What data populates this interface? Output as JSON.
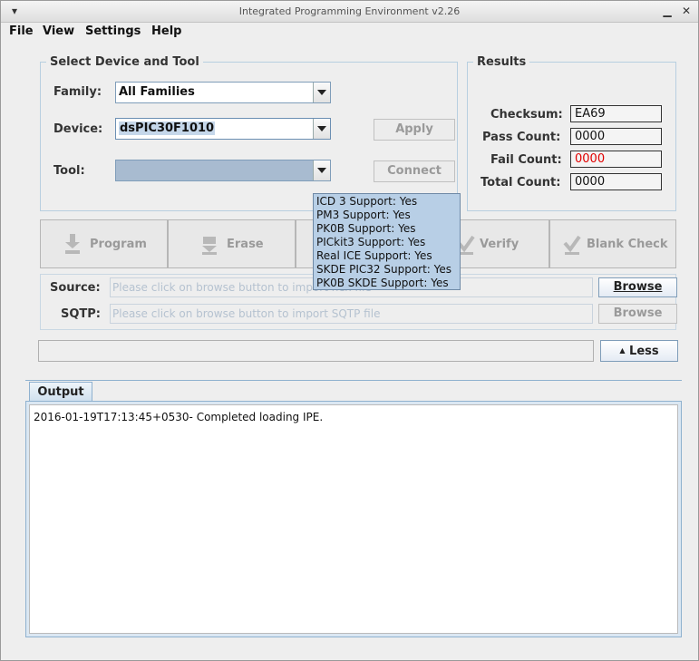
{
  "window": {
    "title": "Integrated Programming Environment v2.26",
    "menu_glyph": "▾",
    "minimize_glyph": "▁",
    "close_glyph": "✕"
  },
  "menu": [
    "File",
    "View",
    "Settings",
    "Help"
  ],
  "device_tool": {
    "group_title": "Select Device and Tool",
    "family_label": "Family:",
    "family_value": "All Families",
    "device_label": "Device:",
    "device_value": "dsPIC30F1010",
    "tool_label": "Tool:",
    "tool_value": "",
    "apply_label": "Apply",
    "connect_label": "Connect"
  },
  "results": {
    "group_title": "Results",
    "checksum_label": "Checksum:",
    "checksum_value": "EA69",
    "pass_label": "Pass Count:",
    "pass_value": "0000",
    "fail_label": "Fail Count:",
    "fail_value": "0000",
    "total_label": "Total Count:",
    "total_value": "0000",
    "fail_color": "#e00000"
  },
  "actions": {
    "program": "Program",
    "erase": "Erase",
    "verify": "Verify",
    "blank_check": "Blank Check"
  },
  "tooltip": [
    "ICD 3 Support: Yes",
    "PM3 Support: Yes",
    "PK0B Support: Yes",
    "PICkit3 Support: Yes",
    "Real ICE Support: Yes",
    "SKDE PIC32 Support: Yes",
    "PK0B SKDE Support: Yes"
  ],
  "source": {
    "label": "Source:",
    "placeholder": "Please click on browse button to import hex file",
    "browse_label": "Browse"
  },
  "sqtp": {
    "label": "SQTP:",
    "placeholder": "Please click on browse button to import SQTP file",
    "browse_label": "Browse"
  },
  "less_label": "Less",
  "less_glyph": "▲",
  "output": {
    "tab_label": "Output",
    "log": "2016-01-19T17:13:45+0530- Completed loading IPE."
  },
  "colors": {
    "accent_border": "#7f9db9",
    "group_border": "#b8cfe0",
    "tooltip_bg": "#b8cfe6"
  }
}
